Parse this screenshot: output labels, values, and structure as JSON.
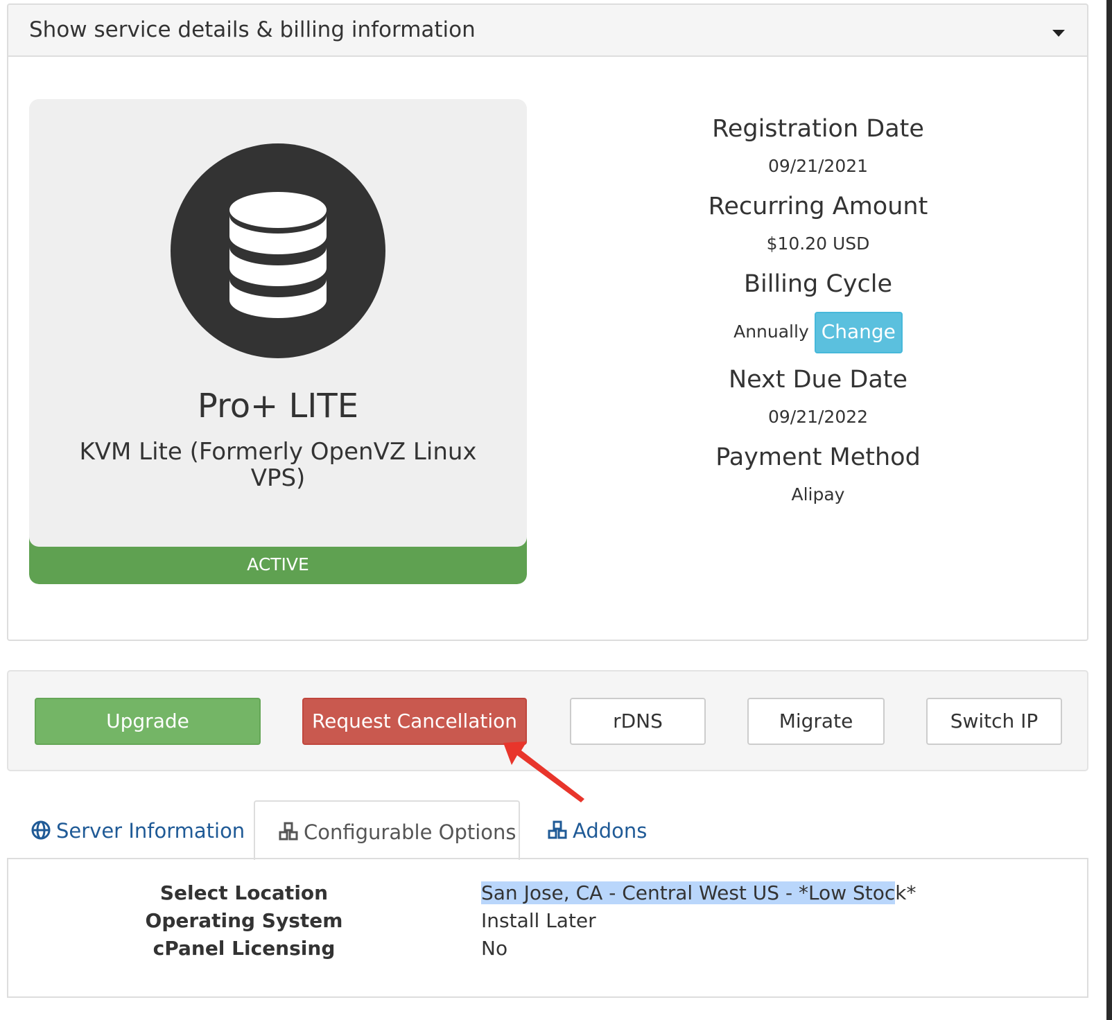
{
  "header": {
    "title": "Show service details & billing information",
    "toggle_icon": "caret-down-icon"
  },
  "product": {
    "icon": "database-icon",
    "name": "Pro+ LITE",
    "group": "KVM Lite (Formerly OpenVZ Linux VPS)",
    "status": "ACTIVE",
    "status_color": "#5fa151"
  },
  "billing": {
    "registration_label": "Registration Date",
    "registration_value": "09/21/2021",
    "recurring_label": "Recurring Amount",
    "recurring_value": "$10.20 USD",
    "cycle_label": "Billing Cycle",
    "cycle_value": "Annually",
    "change_label": "Change",
    "due_label": "Next Due Date",
    "due_value": "09/21/2022",
    "payment_label": "Payment Method",
    "payment_value": "Alipay"
  },
  "actions": {
    "upgrade": "Upgrade",
    "cancel": "Request Cancellation",
    "rdns": "rDNS",
    "migrate": "Migrate",
    "switch_ip": "Switch IP"
  },
  "tabs": [
    {
      "label": "Server Information",
      "icon": "globe-icon"
    },
    {
      "label": "Configurable Options",
      "icon": "cubes-icon",
      "active": true
    },
    {
      "label": "Addons",
      "icon": "cubes-icon"
    }
  ],
  "options": [
    {
      "key": "Select Location",
      "value_highlighted": "San Jose, CA - Central West US - *Low Stoc",
      "value_rest": "k*"
    },
    {
      "key": "Operating System",
      "value": "Install Later"
    },
    {
      "key": "cPanel Licensing",
      "value": "No"
    }
  ]
}
